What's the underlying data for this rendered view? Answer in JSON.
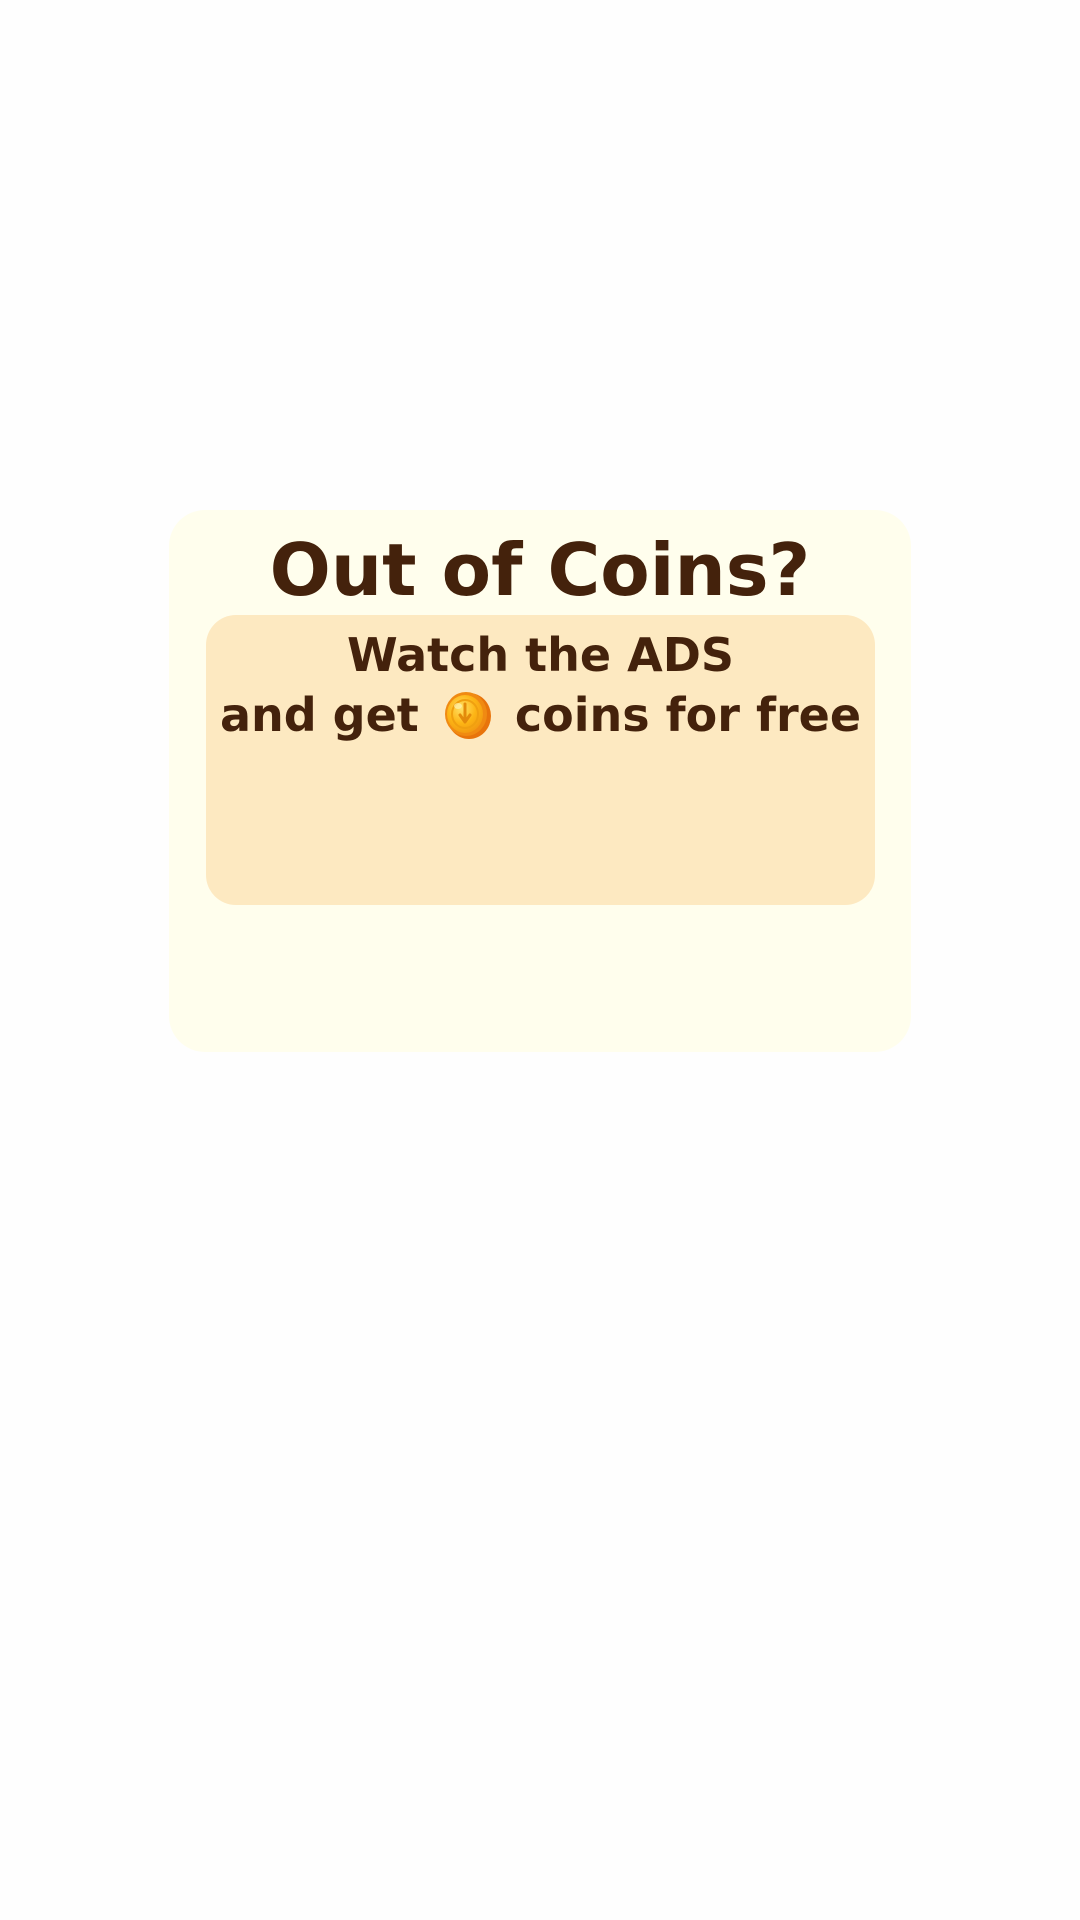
{
  "dialog": {
    "title": "Out of Coins?",
    "message_line1": "Watch the ADS",
    "message_line2_before_icon": "and get",
    "message_line2_after_icon": "coins for free",
    "icon": "coin-icon"
  },
  "colors": {
    "background": "#fefefe",
    "dialog_background": "#fffeed",
    "panel_background": "#fde9c1",
    "text": "#44220c",
    "coin_gold": "#fdb515",
    "coin_rim": "#f08a12"
  }
}
